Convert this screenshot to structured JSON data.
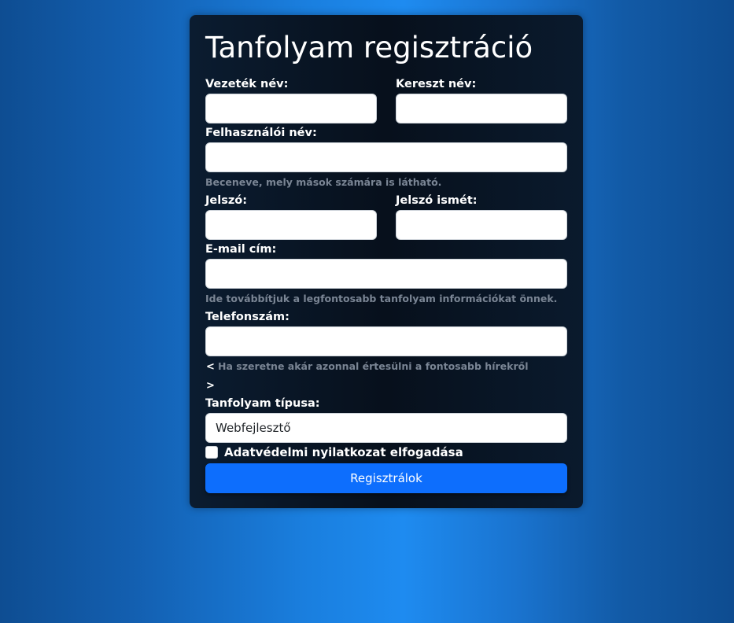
{
  "form": {
    "title": "Tanfolyam regisztráció",
    "fields": {
      "last_name": {
        "label": "Vezeték név:",
        "value": ""
      },
      "first_name": {
        "label": "Kereszt név:",
        "value": ""
      },
      "username": {
        "label": "Felhasználói név:",
        "value": "",
        "help": "Beceneve, mely mások számára is látható."
      },
      "password": {
        "label": "Jelszó:",
        "value": ""
      },
      "password_again": {
        "label": "Jelszó ismét:",
        "value": ""
      },
      "email": {
        "label": "E-mail cím:",
        "value": "",
        "help": "Ide továbbítjuk a legfontosabb tanfolyam információkat önnek."
      },
      "phone": {
        "label": "Telefonszám:",
        "value": "",
        "help_open": "<",
        "help": "Ha szeretne akár azonnal értesülni a fontosabb hírekről",
        "help_close": ">"
      },
      "course_type": {
        "label": "Tanfolyam típusa:",
        "selected": "Webfejlesztő"
      }
    },
    "privacy": {
      "label": "Adatvédelmi nyilatkozat elfogadása",
      "checked": false
    },
    "submit_label": "Regisztrálok"
  },
  "colors": {
    "primary": "#0d6efd",
    "card_background": "#07101c",
    "help_text": "#7a8594"
  }
}
